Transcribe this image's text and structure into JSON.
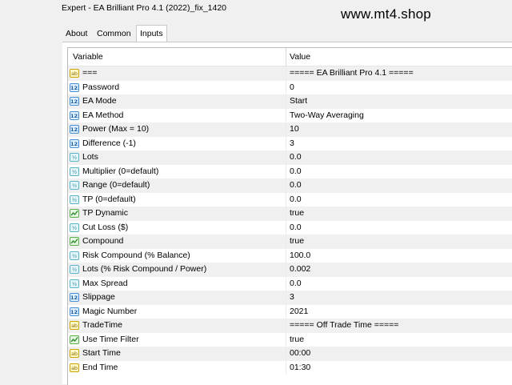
{
  "window": {
    "title": "Expert - EA Brilliant Pro 4.1 (2022)_fix_1420"
  },
  "watermark": "www.mt4.shop",
  "tabs": [
    {
      "label": "About",
      "active": false
    },
    {
      "label": "Common",
      "active": false
    },
    {
      "label": "Inputs",
      "active": true
    }
  ],
  "grid": {
    "columns": {
      "variable": "Variable",
      "value": "Value"
    },
    "rows": [
      {
        "type": "string",
        "icon": "ab",
        "name": "===",
        "value": "===== EA Brilliant Pro 4.1 ====="
      },
      {
        "type": "int",
        "icon": "123",
        "name": "Password",
        "value": "0"
      },
      {
        "type": "int",
        "icon": "123",
        "name": "EA Mode",
        "value": "Start"
      },
      {
        "type": "int",
        "icon": "123",
        "name": "EA Method",
        "value": "Two-Way Averaging"
      },
      {
        "type": "int",
        "icon": "123",
        "name": "Power (Max = 10)",
        "value": "10"
      },
      {
        "type": "int",
        "icon": "123",
        "name": "Difference (-1)",
        "value": "3"
      },
      {
        "type": "double",
        "icon": "½",
        "name": "Lots",
        "value": "0.0"
      },
      {
        "type": "double",
        "icon": "½",
        "name": "Multiplier  (0=default)",
        "value": "0.0"
      },
      {
        "type": "double",
        "icon": "½",
        "name": "Range  (0=default)",
        "value": "0.0"
      },
      {
        "type": "double",
        "icon": "½",
        "name": "TP  (0=default)",
        "value": "0.0"
      },
      {
        "type": "bool",
        "icon": "",
        "name": "TP Dynamic",
        "value": "true"
      },
      {
        "type": "double",
        "icon": "½",
        "name": "Cut Loss ($)",
        "value": "0.0"
      },
      {
        "type": "bool",
        "icon": "",
        "name": "Compound",
        "value": "true"
      },
      {
        "type": "double",
        "icon": "½",
        "name": "Risk Compound (% Balance)",
        "value": "100.0"
      },
      {
        "type": "double",
        "icon": "½",
        "name": "Lots (% Risk Compound / Power)",
        "value": "0.002"
      },
      {
        "type": "double",
        "icon": "½",
        "name": "Max Spread",
        "value": "0.0"
      },
      {
        "type": "int",
        "icon": "123",
        "name": "Slippage",
        "value": "3"
      },
      {
        "type": "int",
        "icon": "123",
        "name": "Magic Number",
        "value": "2021"
      },
      {
        "type": "string",
        "icon": "ab",
        "name": "TradeTime",
        "value": "===== Off Trade Time ====="
      },
      {
        "type": "bool",
        "icon": "",
        "name": "Use Time Filter",
        "value": "true"
      },
      {
        "type": "string",
        "icon": "ab",
        "name": "Start Time",
        "value": "00:00"
      },
      {
        "type": "string",
        "icon": "ab",
        "name": "End Time",
        "value": "01:30"
      }
    ]
  }
}
